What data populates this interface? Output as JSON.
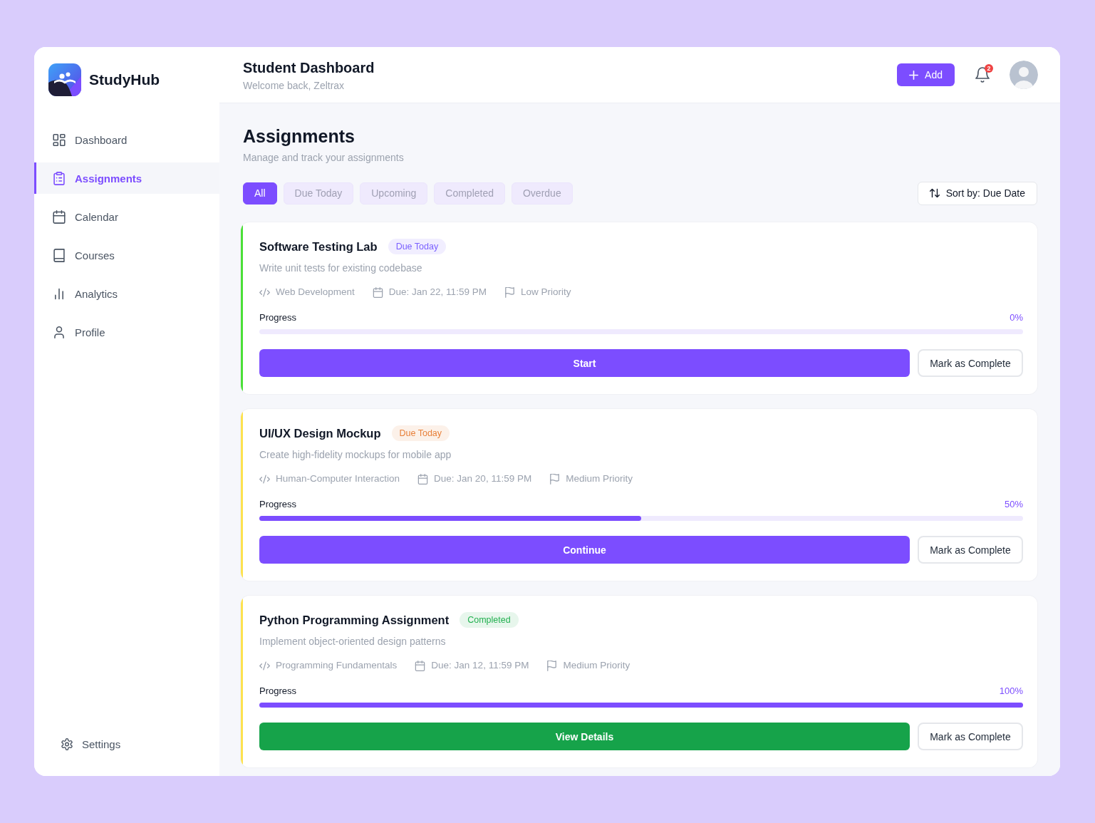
{
  "sidebar": {
    "brand": "StudyHub",
    "items": [
      {
        "label": "Dashboard",
        "selected": false
      },
      {
        "label": "Assignments",
        "selected": true
      },
      {
        "label": "Calendar",
        "selected": false
      },
      {
        "label": "Courses",
        "selected": false
      },
      {
        "label": "Analytics",
        "selected": false
      },
      {
        "label": "Profile",
        "selected": false
      }
    ],
    "settings": "Settings"
  },
  "header": {
    "title": "Student Dashboard",
    "subtitle": "Welcome back, Zeltrax",
    "add_button": "Add",
    "notification_count": "2"
  },
  "page": {
    "title": "Assignments",
    "subtitle": "Manage and track your assignments",
    "filters": [
      {
        "label": "All",
        "selected": true
      },
      {
        "label": "Due Today",
        "selected": false
      },
      {
        "label": "Upcoming",
        "selected": false
      },
      {
        "label": "Completed",
        "selected": false
      },
      {
        "label": "Overdue",
        "selected": false
      }
    ],
    "sort_button": "Sort by: Due Date"
  },
  "assignments": [
    {
      "title": "Software Testing Lab",
      "color": "#4be038",
      "badge": {
        "text": "Due Today",
        "color": "#7b61ff"
      },
      "description": "Write unit tests for existing codebase",
      "course": "Web Development",
      "due": "Due: Jan 22, 11:59 PM",
      "priority": "Low Priority",
      "progress_label": "Progress",
      "progress_text": "0%",
      "level": 0,
      "action": {
        "label": "Start",
        "kind": "primary"
      },
      "secondary_action": "Mark as Complete"
    },
    {
      "title": "UI/UX Design Mockup",
      "color": "#fde24f",
      "badge": {
        "text": "Due Today",
        "color": "#e8803a"
      },
      "description": "Create high-fidelity mockups for mobile app",
      "course": "Human-Computer Interaction",
      "due": "Due: Jan 20, 11:59 PM",
      "priority": "Medium Priority",
      "progress_label": "Progress",
      "progress_text": "50%",
      "level": 0.5,
      "action": {
        "label": "Continue",
        "kind": "primary"
      },
      "secondary_action": "Mark as Complete"
    },
    {
      "title": "Python Programming Assignment",
      "color": "#fde24f",
      "badge": {
        "text": "Completed",
        "color": "#22b04f"
      },
      "description": "Implement object-oriented design patterns",
      "course": "Programming Fundamentals",
      "due": "Due: Jan 12, 11:59 PM",
      "priority": "Medium Priority",
      "progress_label": "Progress",
      "progress_text": "100%",
      "level": 1,
      "action": {
        "label": "View Details",
        "kind": "success"
      },
      "secondary_action": "Mark as Complete"
    }
  ]
}
